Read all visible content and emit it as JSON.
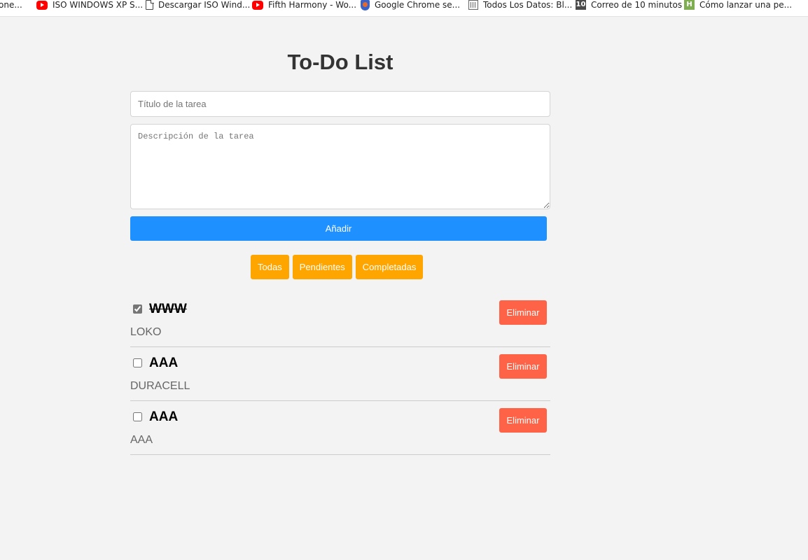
{
  "bookmarks": [
    {
      "icon": "doc-icon",
      "label": "one..."
    },
    {
      "icon": "youtube-icon",
      "label": "ISO WINDOWS XP S..."
    },
    {
      "icon": "doc-icon",
      "label": "Descargar ISO Wind..."
    },
    {
      "icon": "youtube-icon",
      "label": "Fifth Harmony - Wo..."
    },
    {
      "icon": "shield-icon",
      "label": "Google Chrome se..."
    },
    {
      "icon": "grid-icon",
      "label": "Todos Los Datos: Bl..."
    },
    {
      "icon": "ten-minute-mail-icon",
      "label": "Correo de 10 minutos"
    },
    {
      "icon": "h-icon",
      "label": "Cómo lanzar una pe..."
    }
  ],
  "app": {
    "title": "To-Do List",
    "title_input": {
      "placeholder": "Título de la tarea",
      "value": ""
    },
    "description_input": {
      "placeholder": "Descripción de la tarea",
      "value": ""
    },
    "add_label": "Añadir",
    "filters": [
      "Todas",
      "Pendientes",
      "Completadas"
    ],
    "delete_label": "Eliminar",
    "tasks": [
      {
        "title": "WWW",
        "description": "LOKO",
        "completed": true
      },
      {
        "title": "AAA",
        "description": "DURACELL",
        "completed": false
      },
      {
        "title": "AAA",
        "description": "AAA",
        "completed": false
      }
    ]
  },
  "colors": {
    "background": "#f3f3f3",
    "add_button": "#1e90ff",
    "filter_button": "#ffa500",
    "delete_button": "#ff6347",
    "title_text": "#333333"
  }
}
